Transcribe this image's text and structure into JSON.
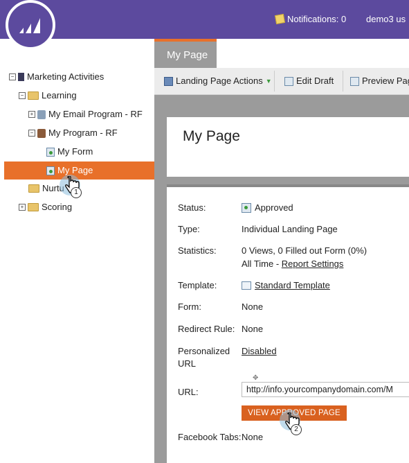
{
  "header": {
    "notifications_label": "Notifications: 0",
    "user_label": "demo3 us",
    "accent_color": "#5c4a9e"
  },
  "tree": {
    "root": "Marketing Activities",
    "learning": "Learning",
    "email_program": "My Email Program - RF",
    "program": "My Program - RF",
    "form": "My Form",
    "page": "My Page",
    "nurture": "Nurtu",
    "scoring": "Scoring"
  },
  "tab": {
    "label": "My Page"
  },
  "toolbar": {
    "landing_actions": "Landing Page Actions",
    "edit_draft": "Edit Draft",
    "preview": "Preview Pag"
  },
  "page_title": "My Page",
  "details": {
    "status_label": "Status:",
    "status_value": "Approved",
    "type_label": "Type:",
    "type_value": "Individual Landing Page",
    "statistics_label": "Statistics:",
    "statistics_value": "0 Views, 0 Filled out Form (0%)",
    "statistics_time": "All Time - ",
    "report_settings": "Report Settings",
    "template_label": "Template:",
    "template_value": "Standard Template",
    "form_label": "Form:",
    "form_value": "None",
    "redirect_label": "Redirect Rule:",
    "redirect_value": "None",
    "personalized_label_1": "Personalized",
    "personalized_label_2": "URL",
    "personalized_value": "Disabled",
    "url_label": "URL:",
    "url_value": "http://info.yourcompanydomain.com/M",
    "view_button": "VIEW APPROVED PAGE",
    "facebook_label": "Facebook Tabs:",
    "facebook_value": "None"
  },
  "callouts": {
    "step1": "1",
    "step2": "2"
  }
}
